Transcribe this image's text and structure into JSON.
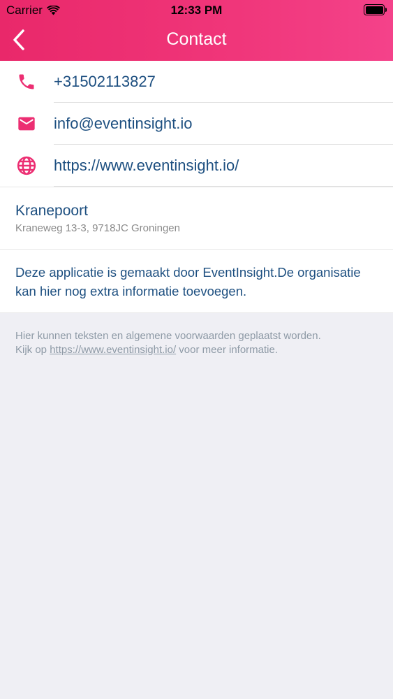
{
  "status_bar": {
    "carrier": "Carrier",
    "time": "12:33 PM"
  },
  "nav": {
    "title": "Contact",
    "back_icon": "chevron-left-icon"
  },
  "colors": {
    "accent": "#ec2e72",
    "text_primary": "#1d4f80",
    "text_secondary": "#8a8a8a"
  },
  "contacts": [
    {
      "icon": "phone-icon",
      "value": "+31502113827"
    },
    {
      "icon": "email-icon",
      "value": "info@eventinsight.io"
    },
    {
      "icon": "globe-icon",
      "value": "https://www.eventinsight.io/"
    }
  ],
  "address": {
    "name": "Kranepoort",
    "street": "Kraneweg 13-3, 9718JC Groningen"
  },
  "about": {
    "text": "Deze applicatie is gemaakt door EventInsight.De organisatie kan hier nog extra informatie toevoegen."
  },
  "footer": {
    "line1": "Hier kunnen teksten en algemene voorwaarden geplaatst worden.",
    "prefix": "Kijk op ",
    "link": "https://www.eventinsight.io/",
    "suffix": " voor meer informatie."
  }
}
